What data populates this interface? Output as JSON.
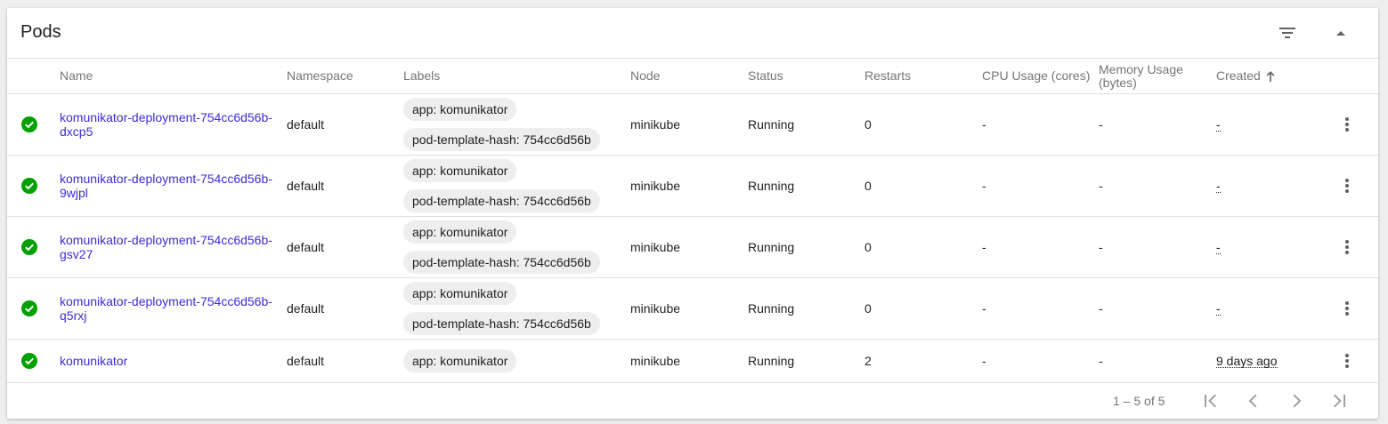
{
  "card": {
    "title": "Pods"
  },
  "columns": {
    "name": "Name",
    "namespace": "Namespace",
    "labels": "Labels",
    "node": "Node",
    "status": "Status",
    "restarts": "Restarts",
    "cpu": "CPU Usage (cores)",
    "memory_line1": "Memory Usage",
    "memory_line2": "(bytes)",
    "created": "Created"
  },
  "rows": [
    {
      "name_line1": "komunikator-deployment-754cc6d56b-",
      "name_line2": "dxcp5",
      "namespace": "default",
      "label1": "app: komunikator",
      "label2": "pod-template-hash: 754cc6d56b",
      "node": "minikube",
      "status": "Running",
      "restarts": "0",
      "cpu": "-",
      "memory": "-",
      "created": "-"
    },
    {
      "name_line1": "komunikator-deployment-754cc6d56b-",
      "name_line2": "9wjpl",
      "namespace": "default",
      "label1": "app: komunikator",
      "label2": "pod-template-hash: 754cc6d56b",
      "node": "minikube",
      "status": "Running",
      "restarts": "0",
      "cpu": "-",
      "memory": "-",
      "created": "-"
    },
    {
      "name_line1": "komunikator-deployment-754cc6d56b-",
      "name_line2": "gsv27",
      "namespace": "default",
      "label1": "app: komunikator",
      "label2": "pod-template-hash: 754cc6d56b",
      "node": "minikube",
      "status": "Running",
      "restarts": "0",
      "cpu": "-",
      "memory": "-",
      "created": "-"
    },
    {
      "name_line1": "komunikator-deployment-754cc6d56b-",
      "name_line2": "q5rxj",
      "namespace": "default",
      "label1": "app: komunikator",
      "label2": "pod-template-hash: 754cc6d56b",
      "node": "minikube",
      "status": "Running",
      "restarts": "0",
      "cpu": "-",
      "memory": "-",
      "created": "-"
    },
    {
      "name_line1": "komunikator",
      "name_line2": "",
      "namespace": "default",
      "label1": "app: komunikator",
      "label2": "",
      "node": "minikube",
      "status": "Running",
      "restarts": "2",
      "cpu": "-",
      "memory": "-",
      "created": "9 days ago"
    }
  ],
  "pagination": {
    "range": "1 – 5 of 5"
  },
  "icons": {
    "status": "check-circle-icon",
    "filter": "filter-list-icon",
    "collapse": "arrow-drop-up-icon",
    "sort": "arrow-upward-icon",
    "more": "more-vert-icon",
    "first": "first-page-icon",
    "prev": "chevron-left-icon",
    "next": "chevron-right-icon",
    "last": "last-page-icon"
  },
  "colors": {
    "success": "#00a000",
    "link": "#3c2bd8",
    "chip": "#eeeeee"
  }
}
